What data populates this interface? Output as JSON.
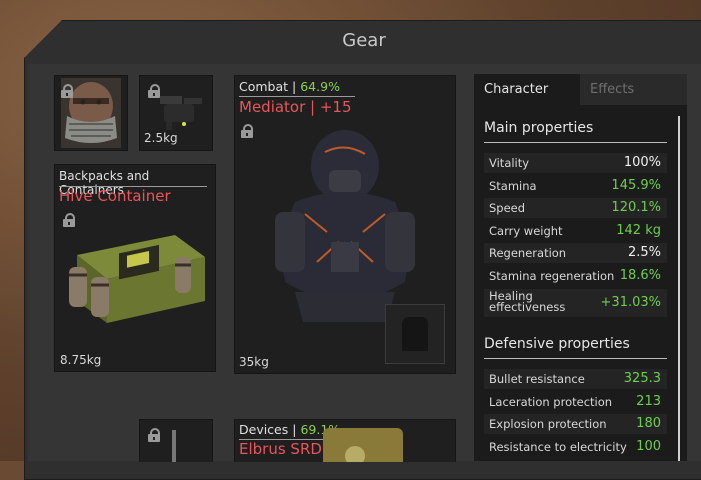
{
  "window": {
    "title": "Gear"
  },
  "slots": {
    "face_weight": "",
    "drone_weight": "2.5kg",
    "backpack": {
      "category": "Backpacks and Containers",
      "name": "Hive Container",
      "weight": "8.75kg"
    },
    "armor": {
      "category": "Combat",
      "percent": "64.9%",
      "name": "Mediator | +15",
      "weight": "35kg"
    },
    "devices": {
      "category": "Devices",
      "percent": "69.1%",
      "name": "Elbrus SRD"
    }
  },
  "tabs": {
    "character": "Character",
    "effects": "Effects"
  },
  "main_properties": {
    "title": "Main properties",
    "rows": [
      {
        "label": "Vitality",
        "value": "100%",
        "color": "white"
      },
      {
        "label": "Stamina",
        "value": "145.9%",
        "color": "green"
      },
      {
        "label": "Speed",
        "value": "120.1%",
        "color": "green"
      },
      {
        "label": "Carry weight",
        "value": "142 kg",
        "color": "green"
      },
      {
        "label": "Regeneration",
        "value": "2.5%",
        "color": "white"
      },
      {
        "label": "Stamina regeneration",
        "value": "18.6%",
        "color": "green"
      },
      {
        "label": "Healing effectiveness",
        "label_line1": "Healing",
        "label_line2": "effectiveness",
        "value": "+31.03%",
        "color": "green"
      }
    ]
  },
  "defensive_properties": {
    "title": "Defensive properties",
    "rows": [
      {
        "label": "Bullet resistance",
        "value": "325.3",
        "color": "green"
      },
      {
        "label": "Laceration protection",
        "value": "213",
        "color": "green"
      },
      {
        "label": "Explosion protection",
        "value": "180",
        "color": "green"
      },
      {
        "label": "Resistance to electricity",
        "value": "100",
        "color": "green"
      }
    ]
  },
  "colors": {
    "accent_red": "#e8555a",
    "stat_green": "#6fcf4a",
    "percent_green": "#8bd14f"
  }
}
